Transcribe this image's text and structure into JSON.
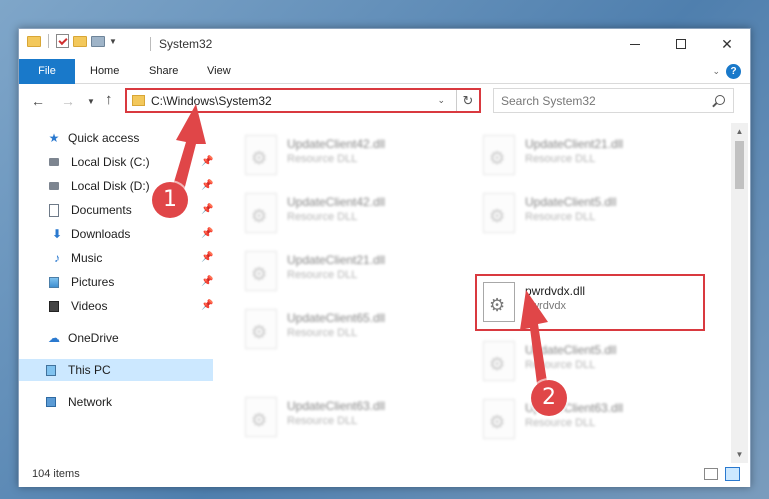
{
  "window": {
    "title": "System32",
    "controls": {
      "minimize": "minimize-icon",
      "maximize": "maximize-icon",
      "close": "✕"
    }
  },
  "ribbon": {
    "tabs": [
      "File",
      "Home",
      "Share",
      "View"
    ],
    "help": "?"
  },
  "navigation": {
    "address": "C:\\Windows\\System32",
    "search_placeholder": "Search System32"
  },
  "sidebar": {
    "items": [
      {
        "label": "Quick access",
        "icon": "star-icon",
        "pinned": false
      },
      {
        "label": "Local Disk (C:)",
        "icon": "disk-icon",
        "pinned": true
      },
      {
        "label": "Local Disk (D:)",
        "icon": "disk-icon",
        "pinned": true
      },
      {
        "label": "Documents",
        "icon": "documents-icon",
        "pinned": true
      },
      {
        "label": "Downloads",
        "icon": "download-icon",
        "pinned": true
      },
      {
        "label": "Music",
        "icon": "music-icon",
        "pinned": true
      },
      {
        "label": "Pictures",
        "icon": "pictures-icon",
        "pinned": true
      },
      {
        "label": "Videos",
        "icon": "videos-icon",
        "pinned": true
      },
      {
        "label": "OneDrive",
        "icon": "cloud-icon",
        "pinned": false
      },
      {
        "label": "This PC",
        "icon": "computer-icon",
        "pinned": false,
        "selected": true
      },
      {
        "label": "Network",
        "icon": "network-icon",
        "pinned": false
      }
    ]
  },
  "files": [
    {
      "name": "UpdateClient42.dll",
      "type": "Resource DLL"
    },
    {
      "name": "UpdateClient21.dll",
      "type": "Resource DLL"
    },
    {
      "name": "UpdateClient42.dll",
      "type": "Resource DLL"
    },
    {
      "name": "UpdateClient5.dll",
      "type": "Resource DLL"
    },
    {
      "name": "UpdateClient21.dll",
      "type": "Resource DLL"
    },
    {
      "name": "pwrdvdx.dll",
      "type": "pwrdvdx"
    },
    {
      "name": "UpdateClient65.dll",
      "type": "Resource DLL"
    },
    {
      "name": "UpdateClient5.dll",
      "type": "Resource DLL"
    },
    {
      "name": "UpdateClient63.dll",
      "type": "Resource DLL"
    },
    {
      "name": "UpdateClient63.dll",
      "type": "Resource DLL"
    }
  ],
  "status": {
    "item_count": "104 items"
  },
  "annotations": {
    "step1": "1",
    "step2": "2",
    "color": "#d9393f"
  }
}
